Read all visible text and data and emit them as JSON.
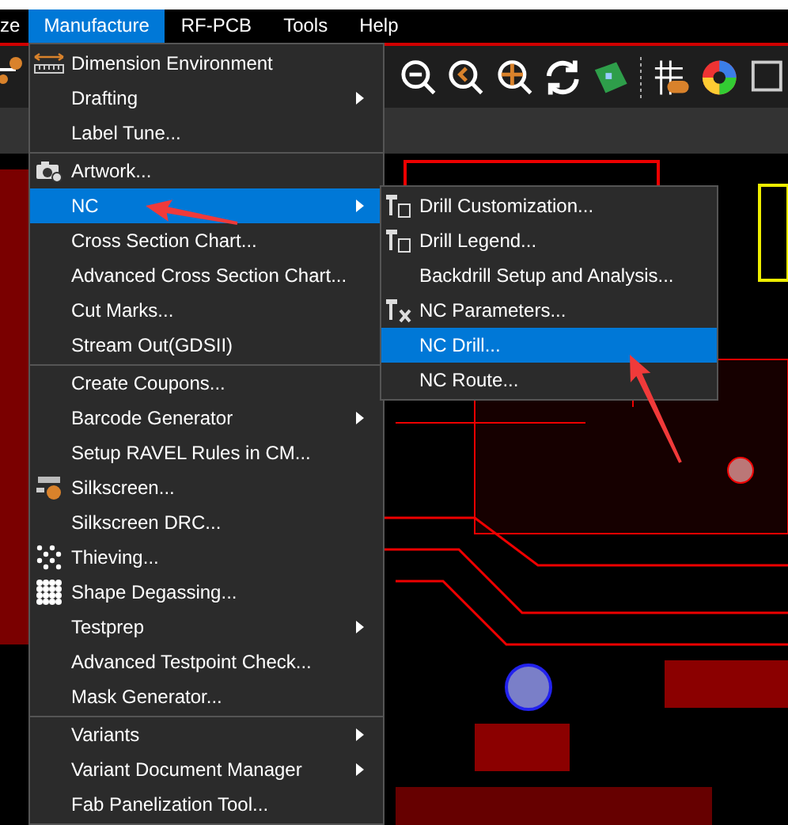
{
  "menubar": [
    {
      "label": "ze",
      "selected": false
    },
    {
      "label": "Manufacture",
      "selected": true
    },
    {
      "label": "RF-PCB",
      "selected": false
    },
    {
      "label": "Tools",
      "selected": false
    },
    {
      "label": "Help",
      "selected": false
    }
  ],
  "menu": {
    "groups": [
      [
        {
          "label": "Dimension Environment",
          "submenu": false,
          "selected": false
        },
        {
          "label": "Drafting",
          "submenu": true,
          "selected": false
        },
        {
          "label": "Label Tune...",
          "submenu": false,
          "selected": false
        }
      ],
      [
        {
          "label": "Artwork...",
          "submenu": false,
          "selected": false
        },
        {
          "label": "NC",
          "submenu": true,
          "selected": true
        },
        {
          "label": "Cross Section Chart...",
          "submenu": false,
          "selected": false
        },
        {
          "label": "Advanced Cross Section Chart...",
          "submenu": false,
          "selected": false
        },
        {
          "label": "Cut Marks...",
          "submenu": false,
          "selected": false
        },
        {
          "label": "Stream Out(GDSII)",
          "submenu": false,
          "selected": false
        }
      ],
      [
        {
          "label": "Create Coupons...",
          "submenu": false,
          "selected": false
        },
        {
          "label": "Barcode Generator",
          "submenu": true,
          "selected": false
        },
        {
          "label": "Setup RAVEL Rules in CM...",
          "submenu": false,
          "selected": false
        },
        {
          "label": "Silkscreen...",
          "submenu": false,
          "selected": false
        },
        {
          "label": "Silkscreen DRC...",
          "submenu": false,
          "selected": false
        },
        {
          "label": "Thieving...",
          "submenu": false,
          "selected": false
        },
        {
          "label": "Shape Degassing...",
          "submenu": false,
          "selected": false
        },
        {
          "label": "Testprep",
          "submenu": true,
          "selected": false
        },
        {
          "label": "Advanced Testpoint Check...",
          "submenu": false,
          "selected": false
        },
        {
          "label": "Mask Generator...",
          "submenu": false,
          "selected": false
        }
      ],
      [
        {
          "label": "Variants",
          "submenu": true,
          "selected": false
        },
        {
          "label": "Variant Document Manager",
          "submenu": true,
          "selected": false
        },
        {
          "label": "Fab Panelization Tool...",
          "submenu": false,
          "selected": false
        }
      ]
    ]
  },
  "submenu": {
    "items": [
      {
        "label": "Drill Customization...",
        "selected": false
      },
      {
        "label": "Drill Legend...",
        "selected": false
      },
      {
        "label": "Backdrill Setup and Analysis...",
        "selected": false
      },
      {
        "label": "NC Parameters...",
        "selected": false
      },
      {
        "label": "NC Drill...",
        "selected": true
      },
      {
        "label": "NC Route...",
        "selected": false
      }
    ]
  }
}
